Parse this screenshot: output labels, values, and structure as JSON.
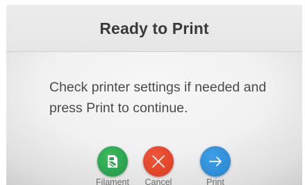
{
  "dialog": {
    "title": "Ready to Print",
    "message_line1": "Check printer settings if needed and",
    "message_line2": "press Print to continue."
  },
  "actions": [
    {
      "label": "Filament",
      "icon": "filament-spool-icon",
      "color": "#2aa24c"
    },
    {
      "label": "Cancel",
      "icon": "close-x-icon",
      "color": "#e0462a"
    },
    {
      "label": "Print",
      "icon": "arrow-right-icon",
      "color": "#2f8fd6"
    }
  ]
}
